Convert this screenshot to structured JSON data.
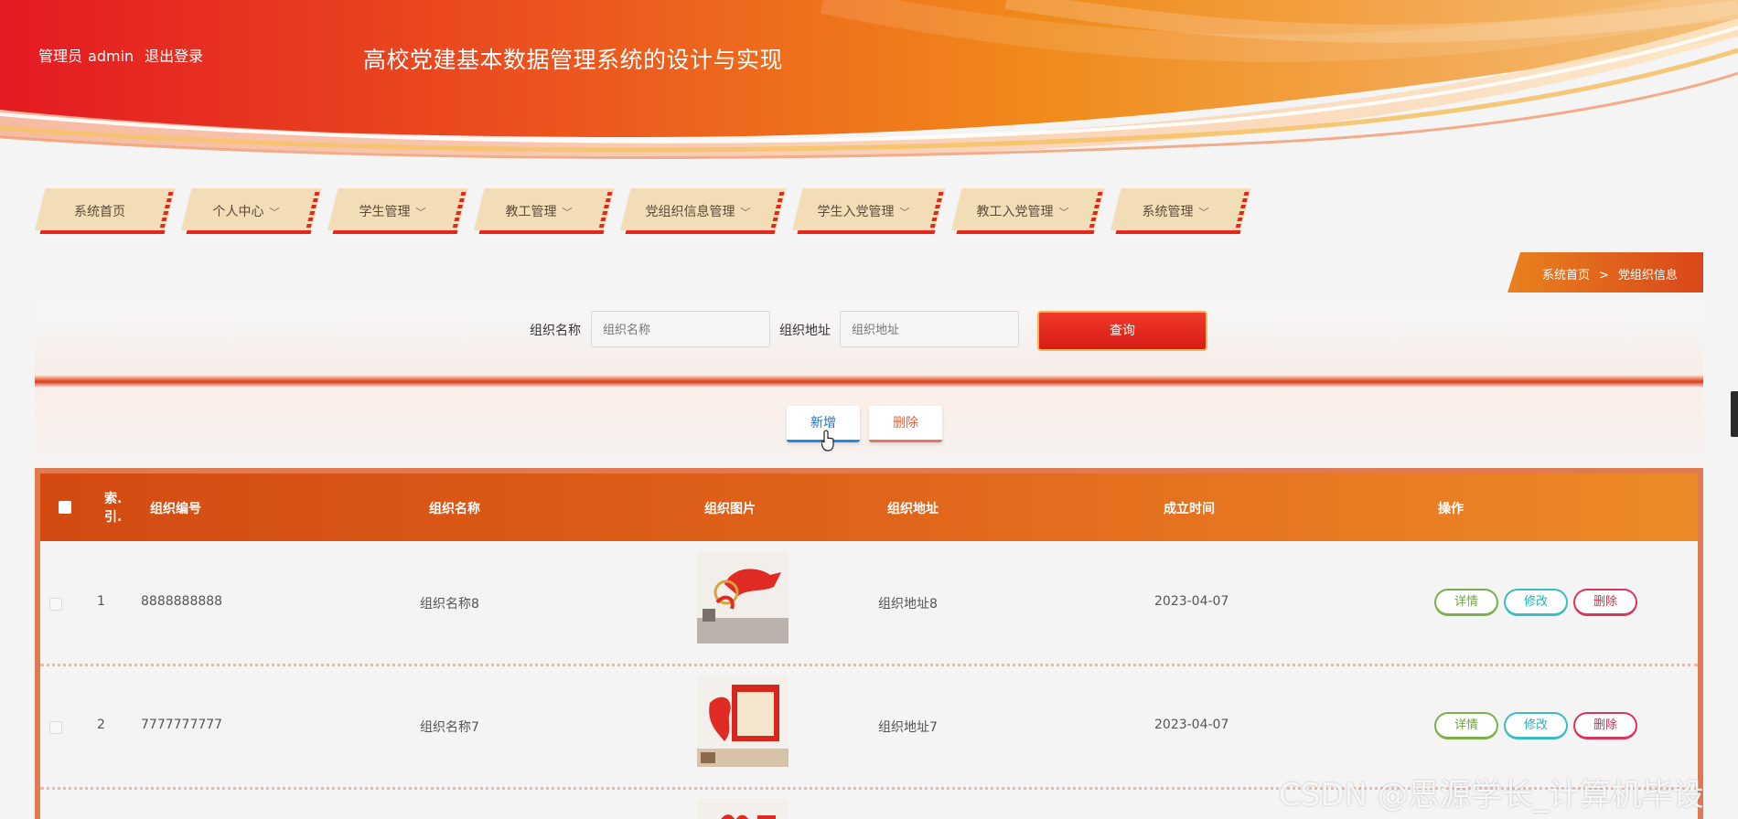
{
  "header": {
    "role": "管理员",
    "username": "admin",
    "logout": "退出登录",
    "title": "高校党建基本数据管理系统的设计与实现"
  },
  "nav": {
    "items": [
      {
        "label": "系统首页",
        "has_menu": false
      },
      {
        "label": "个人中心",
        "has_menu": true
      },
      {
        "label": "学生管理",
        "has_menu": true
      },
      {
        "label": "教工管理",
        "has_menu": true
      },
      {
        "label": "党组织信息管理",
        "has_menu": true
      },
      {
        "label": "学生入党管理",
        "has_menu": true
      },
      {
        "label": "教工入党管理",
        "has_menu": true
      },
      {
        "label": "系统管理",
        "has_menu": true
      }
    ],
    "chevron": "﹀"
  },
  "breadcrumb": {
    "home": "系统首页",
    "separator": ">",
    "current": "党组织信息"
  },
  "search": {
    "name_label": "组织名称",
    "name_placeholder": "组织名称",
    "address_label": "组织地址",
    "address_placeholder": "组织地址",
    "query_label": "查询"
  },
  "actions": {
    "add_label": "新增",
    "delete_label": "删除"
  },
  "table": {
    "columns": {
      "index_line1": "索.",
      "index_line2": "引.",
      "code": "组织编号",
      "name": "组织名称",
      "image": "组织图片",
      "address": "组织地址",
      "date": "成立时间",
      "ops": "操作"
    },
    "rows": [
      {
        "index": "1",
        "code": "8888888888",
        "name": "组织名称8",
        "address": "组织地址8",
        "date": "2023-04-07"
      },
      {
        "index": "2",
        "code": "7777777777",
        "name": "组织名称7",
        "address": "组织地址7",
        "date": "2023-04-07"
      }
    ],
    "op_labels": {
      "detail": "详情",
      "edit": "修改",
      "remove": "删除"
    }
  },
  "watermark": "CSDN @思源学长_计算机毕设",
  "colors": {
    "primary_red": "#e5261c",
    "header_orange": "#ef8a1f",
    "nav_bg": "#f3ddb6"
  }
}
